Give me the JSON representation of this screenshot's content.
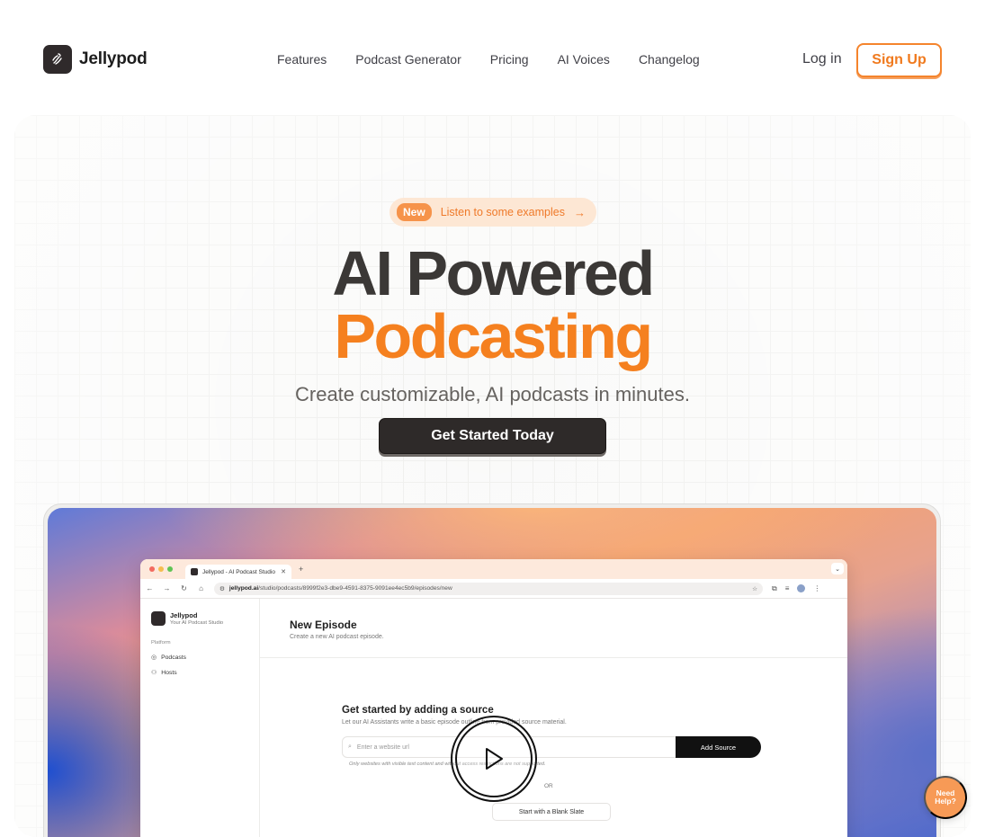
{
  "nav": {
    "brand": "Jellypod",
    "links": [
      "Features",
      "Podcast Generator",
      "Pricing",
      "AI Voices",
      "Changelog"
    ],
    "login": "Log in",
    "signup": "Sign Up"
  },
  "hero": {
    "badge": "New",
    "badge_link": "Listen to some examples",
    "title_line1": "AI Powered",
    "title_line2": "Podcasting",
    "subtitle": "Create customizable, AI podcasts in minutes.",
    "cta": "Get Started Today"
  },
  "screenshot": {
    "tab_title": "Jellypod - AI Podcast Studio",
    "url_host": "jellypod.ai",
    "url_path": "/studio/podcasts/8999f2e3-dbe9-4591-8375-9091ee4ec5b9/episodes/new",
    "app_name": "Jellypod",
    "app_tagline": "Your AI Podcast Studio",
    "section": "Platform",
    "sidebar_items": [
      "Podcasts",
      "Hosts"
    ],
    "page_title": "New Episode",
    "page_subtitle": "Create a new AI podcast episode.",
    "source_title": "Get started by adding a source",
    "source_sub": "Let our AI Assistants write a basic episode outline from provided source material.",
    "input_placeholder": "Enter a website url",
    "add_source": "Add Source",
    "note": "Only websites with visible text content and without access restrictions are not supported.",
    "or": "OR",
    "blank": "Start with a Blank Slate"
  },
  "help": "Need Help?",
  "colors": {
    "accent": "#f5801f",
    "dark": "#2e2a29",
    "badge_bg": "#fde7d4"
  }
}
